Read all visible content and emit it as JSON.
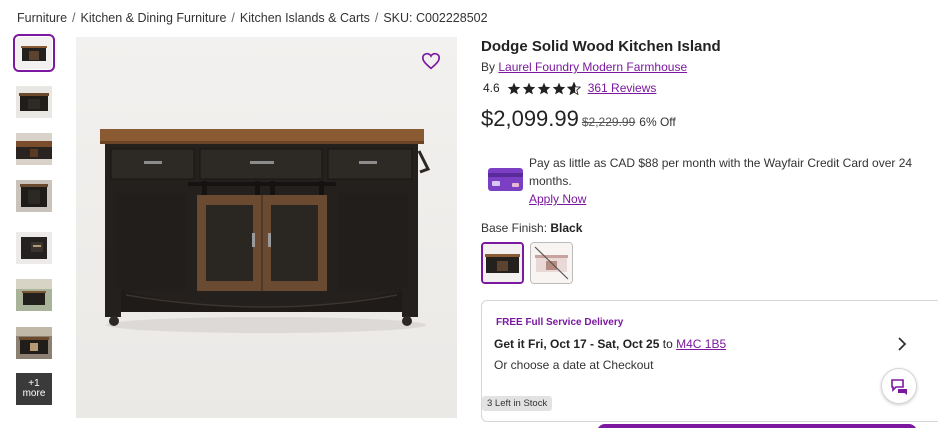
{
  "breadcrumb": {
    "items": [
      "Furniture",
      "Kitchen & Dining Furniture",
      "Kitchen Islands & Carts"
    ],
    "separator": "/",
    "sku": "SKU: C002228502"
  },
  "gallery": {
    "more_plus": "+1",
    "more_label": "more"
  },
  "product": {
    "title": "Dodge Solid Wood Kitchen Island",
    "by_prefix": "By",
    "brand": "Laurel Foundry Modern Farmhouse",
    "rating": "4.6",
    "rating_value": 4.6,
    "reviews": "361 Reviews",
    "price": "$2,099.99",
    "original_price": "$2,229.99",
    "discount": "6% Off"
  },
  "credit": {
    "text": "Pay as little as CAD $88 per month with the Wayfair Credit Card over 24 months.",
    "apply": "Apply Now"
  },
  "finish": {
    "label": "Base Finish:",
    "value": "Black"
  },
  "delivery": {
    "tag": "FREE Full Service Delivery",
    "get_it": "Get it",
    "dates": "Fri, Oct 17 - Sat, Oct 25",
    "to": "to",
    "postal": "M4C 1B5",
    "alt": "Or choose a date at Checkout"
  },
  "stock": "3 Left in Stock",
  "colors": {
    "accent": "#7b189f",
    "wood_top": "#8a5a33",
    "cabinet": "#24201d"
  }
}
